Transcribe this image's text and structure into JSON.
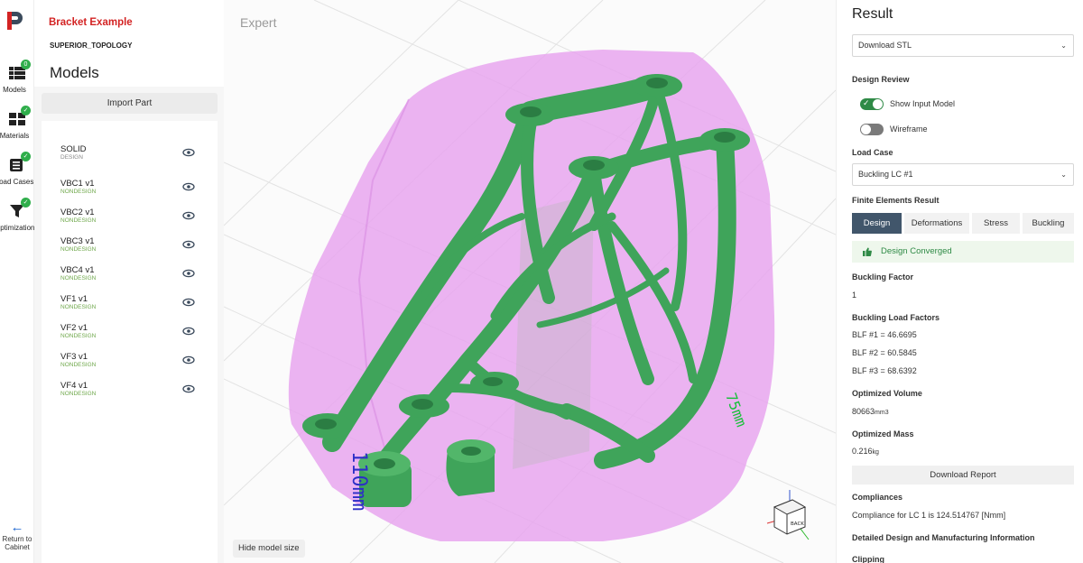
{
  "rail": {
    "items": [
      {
        "label": "Models",
        "badge": "0"
      },
      {
        "label": "Materials"
      },
      {
        "label": "Load Cases"
      },
      {
        "label": "Optimization"
      }
    ],
    "return_label_1": "Return to",
    "return_label_2": "Cabinet"
  },
  "project": {
    "title": "Bracket Example",
    "subtitle": "SUPERIOR_TOPOLOGY"
  },
  "models": {
    "title": "Models",
    "import_label": "Import Part",
    "items": [
      {
        "name": "SOLID",
        "type": "DESIGN"
      },
      {
        "name": "VBC1 v1",
        "type": "NONDESIGN"
      },
      {
        "name": "VBC2 v1",
        "type": "NONDESIGN"
      },
      {
        "name": "VBC3 v1",
        "type": "NONDESIGN"
      },
      {
        "name": "VBC4 v1",
        "type": "NONDESIGN"
      },
      {
        "name": "VF1 v1",
        "type": "NONDESIGN"
      },
      {
        "name": "VF2 v1",
        "type": "NONDESIGN"
      },
      {
        "name": "VF3 v1",
        "type": "NONDESIGN"
      },
      {
        "name": "VF4 v1",
        "type": "NONDESIGN"
      }
    ]
  },
  "viewport": {
    "mode_label": "Expert",
    "hide_label": "Hide model size",
    "dim_label_blue": "110mm",
    "dim_label_green": "75mm",
    "cube_face": "BACK"
  },
  "result": {
    "title": "Result",
    "download_select": "Download STL",
    "design_review_label": "Design Review",
    "show_input_label": "Show Input Model",
    "wireframe_label": "Wireframe",
    "load_case_label": "Load Case",
    "load_case_value": "Buckling LC #1",
    "fe_result_label": "Finite Elements Result",
    "tabs": [
      "Design",
      "Deformations",
      "Stress",
      "Buckling"
    ],
    "converged_label": "Design Converged",
    "buckling_factor_label": "Buckling Factor",
    "buckling_factor_value": "1",
    "blf_label": "Buckling Load Factors",
    "blf_values": [
      "BLF #1 = 46.6695",
      "BLF #2 = 60.5845",
      "BLF #3 = 68.6392"
    ],
    "volume_label": "Optimized Volume",
    "volume_value": "80663",
    "volume_unit": "mm3",
    "mass_label": "Optimized Mass",
    "mass_value": "0.216",
    "mass_unit": "kg",
    "report_label": "Download Report",
    "compliances_label": "Compliances",
    "compliance_value": "Compliance for LC 1 is 124.514767 [Nmm]",
    "detailed_label": "Detailed Design and Manufacturing Information",
    "clipping_label": "Clipping"
  },
  "colors": {
    "accent_red": "#d32323",
    "accent_green": "#2f8a46",
    "tab_active": "#41566b",
    "model_green": "#3fa45a",
    "envelope_pink": "#e7a6ee"
  }
}
